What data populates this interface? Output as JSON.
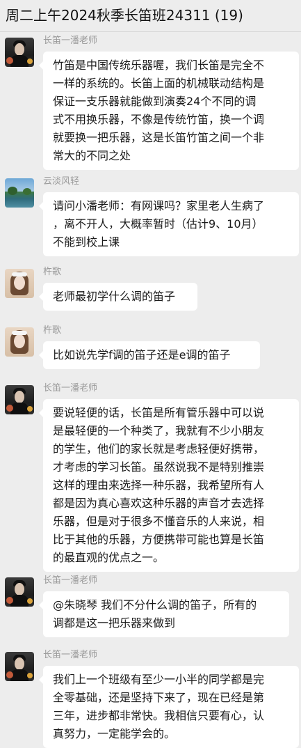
{
  "header": {
    "title": "周二上午2024秋季长笛班24311 (19)"
  },
  "messages": [
    {
      "sender": "长笛一潘老师",
      "avatar": "teacher-avatar",
      "lines": [
        "竹笛是中国传统乐器喔，我们长笛是完全不",
        "一样的系统的。长笛上面的机械联动结构是",
        "保证一支乐器就能做到演奏24个不同的调",
        "式不用换乐器，不像是传统竹笛，换一个调",
        "就要换一把乐器，这是长笛竹笛之间一个非",
        "常大的不同之处"
      ]
    },
    {
      "sender": "云淡风轻",
      "avatar": "lake-avatar",
      "lines": [
        "请问小潘老师：有网课吗？家里老人生病了",
        "，离不开人，大概率暂时（估计9、10月）",
        "不能到校上课"
      ]
    },
    {
      "sender": "杵歌",
      "avatar": "girl-avatar",
      "lines": [
        "老师最初学什么调的笛子"
      ]
    },
    {
      "sender": "杵歌",
      "avatar": "girl-avatar",
      "lines": [
        "比如说先学f调的笛子还是e调的笛子"
      ]
    },
    {
      "sender": "长笛一潘老师",
      "avatar": "teacher-avatar",
      "lines": [
        "要说轻便的话，长笛是所有管乐器中可以说",
        "是最轻便的一个种类了，我就有不少小朋友",
        "的学生，他们的家长就是考虑轻便好携带，",
        "才考虑的学习长笛。虽然说我不是特别推崇",
        "这样的理由来选择一种乐器，我希望所有人",
        "都是因为真心喜欢这种乐器的声音才去选择",
        "乐器，但是对于很多不懂音乐的人来说，相",
        "比于其他的乐器，方便携带可能也算是长笛",
        "的最直观的优点之一。"
      ]
    },
    {
      "sender": "长笛一潘老师",
      "avatar": "teacher-avatar",
      "lines": [
        "@朱晓琴 我们不分什么调的笛子，所有的",
        "调都是这一把乐器来做到"
      ]
    },
    {
      "sender": "长笛一潘老师",
      "avatar": "teacher-avatar",
      "lines": [
        "我们上一个班级有至少一小半的同学都是完",
        "全零基础，还是坚持下来了，现在已经是第",
        "三年，进步都非常快。我相信只要有心，认",
        "真努力，一定能学会的。"
      ]
    }
  ]
}
